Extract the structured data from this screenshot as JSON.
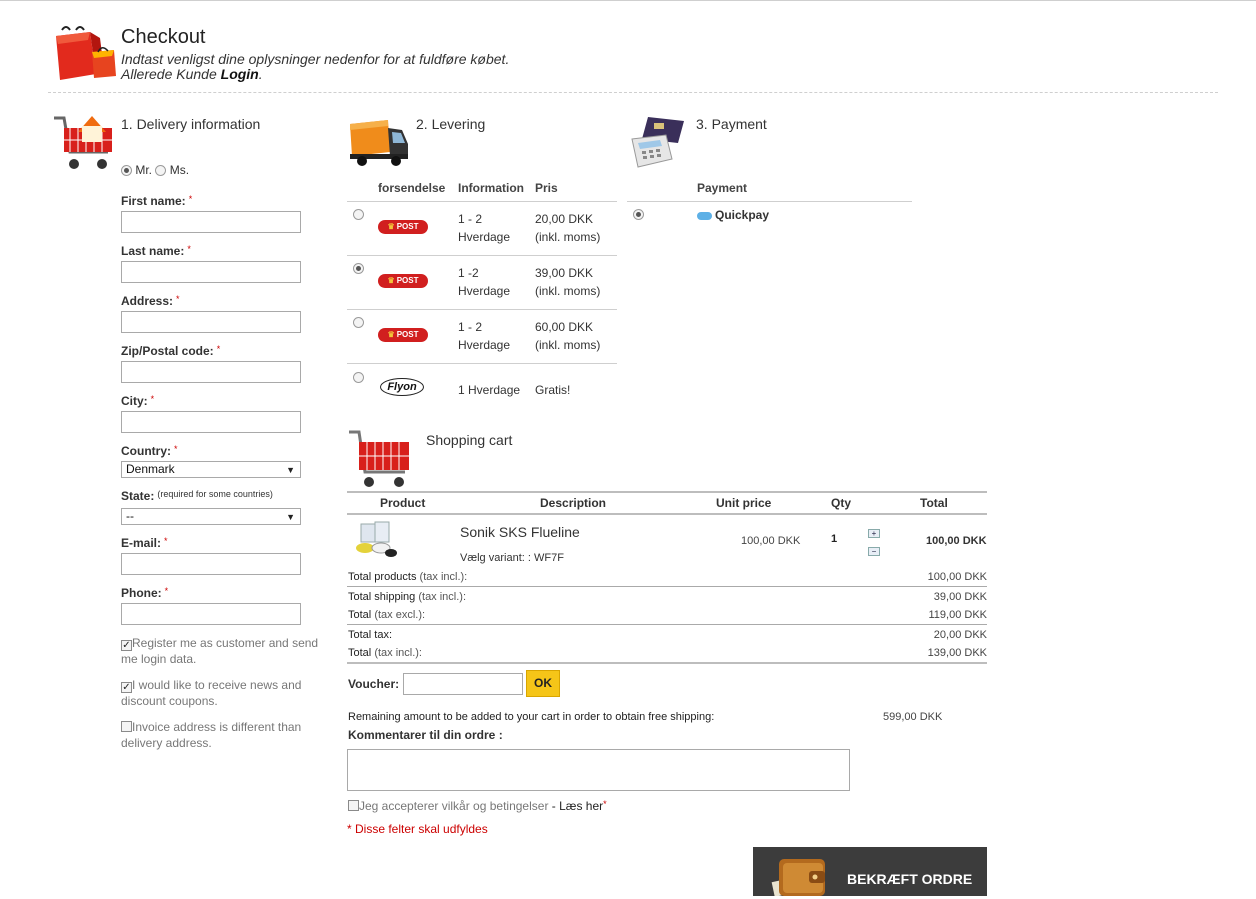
{
  "header": {
    "title": "Checkout",
    "subtitle": "Indtast venligst dine oplysninger nedenfor for at fuldføre købet.",
    "customer_prefix": "Allerede Kunde ",
    "login_link": "Login",
    "login_suffix": "."
  },
  "delivery": {
    "title": "1. Delivery information",
    "salutation": {
      "mr": "Mr.",
      "ms": "Ms.",
      "selected": "Mr."
    },
    "required_marker": "*",
    "fields": {
      "first_name": "First name:",
      "last_name": "Last name:",
      "address": "Address:",
      "zip": "Zip/Postal code:",
      "city": "City:",
      "country": "Country:",
      "state": "State:",
      "state_note": "(required for some countries)",
      "email": "E-mail:",
      "phone": "Phone:"
    },
    "country_value": "Denmark",
    "state_value": "--",
    "checkboxes": {
      "register": "Register me as customer and send me login data.",
      "news": "I would like to receive news and discount coupons.",
      "invoice": "Invoice address is different than delivery address."
    }
  },
  "shipping": {
    "title": "2. Levering",
    "headers": {
      "method": "forsendelse",
      "info": "Information",
      "price": "Pris"
    },
    "options": [
      {
        "logo": "POST",
        "info_1": "1 - 2",
        "info_2": "Hverdage",
        "price_1": "20,00 DKK",
        "price_2": "(inkl. moms)",
        "selected": false
      },
      {
        "logo": "POST",
        "info_1": "1 -2",
        "info_2": "Hverdage",
        "price_1": "39,00 DKK",
        "price_2": "(inkl. moms)",
        "selected": true
      },
      {
        "logo": "POST",
        "info_1": "1 - 2",
        "info_2": "Hverdage",
        "price_1": "60,00 DKK",
        "price_2": "(inkl. moms)",
        "selected": false
      }
    ],
    "flyon": {
      "logo": "Flyon",
      "info": "1 Hverdage",
      "price": "Gratis!"
    }
  },
  "payment": {
    "title": "3. Payment",
    "header": "Payment",
    "method": "Quickpay"
  },
  "cart": {
    "title": "Shopping cart",
    "headers": {
      "product": "Product",
      "description": "Description",
      "unit_price": "Unit price",
      "qty": "Qty",
      "total": "Total"
    },
    "item": {
      "name": "Sonik SKS Flueline",
      "variant": "Vælg variant: : WF7F",
      "unit_price": "100,00 DKK",
      "qty": "1",
      "total": "100,00 DKK",
      "plus": "+",
      "minus": "−"
    },
    "totals": {
      "products_label": "Total products",
      "products_note": "(tax incl.):",
      "products_value": "100,00 DKK",
      "shipping_label": "Total shipping",
      "shipping_note": "(tax incl.):",
      "shipping_value": "39,00 DKK",
      "excl_label": "Total",
      "excl_note": "(tax excl.):",
      "excl_value": "119,00 DKK",
      "tax_label": "Total tax:",
      "tax_value": "20,00 DKK",
      "incl_label": "Total",
      "incl_note": "(tax incl.):",
      "incl_value": "139,00 DKK"
    },
    "voucher_label": "Voucher:",
    "voucher_button": "OK",
    "free_shipping_text": "Remaining amount to be added to your cart in order to obtain free shipping:",
    "free_shipping_value": "599,00 DKK",
    "comment_label": "Kommentarer til din ordre :",
    "terms_text": "Jeg accepterer vilkår og betingelser",
    "terms_link": " - Læs her",
    "required_note": "* Disse felter skal udfyldes",
    "confirm_button": "BEKRÆFT ORDRE"
  },
  "colors": {
    "required_red": "#cc0000",
    "ok_button": "#f5c518",
    "confirm_bg": "#3c3c3c",
    "post_red": "#d11f1f"
  }
}
